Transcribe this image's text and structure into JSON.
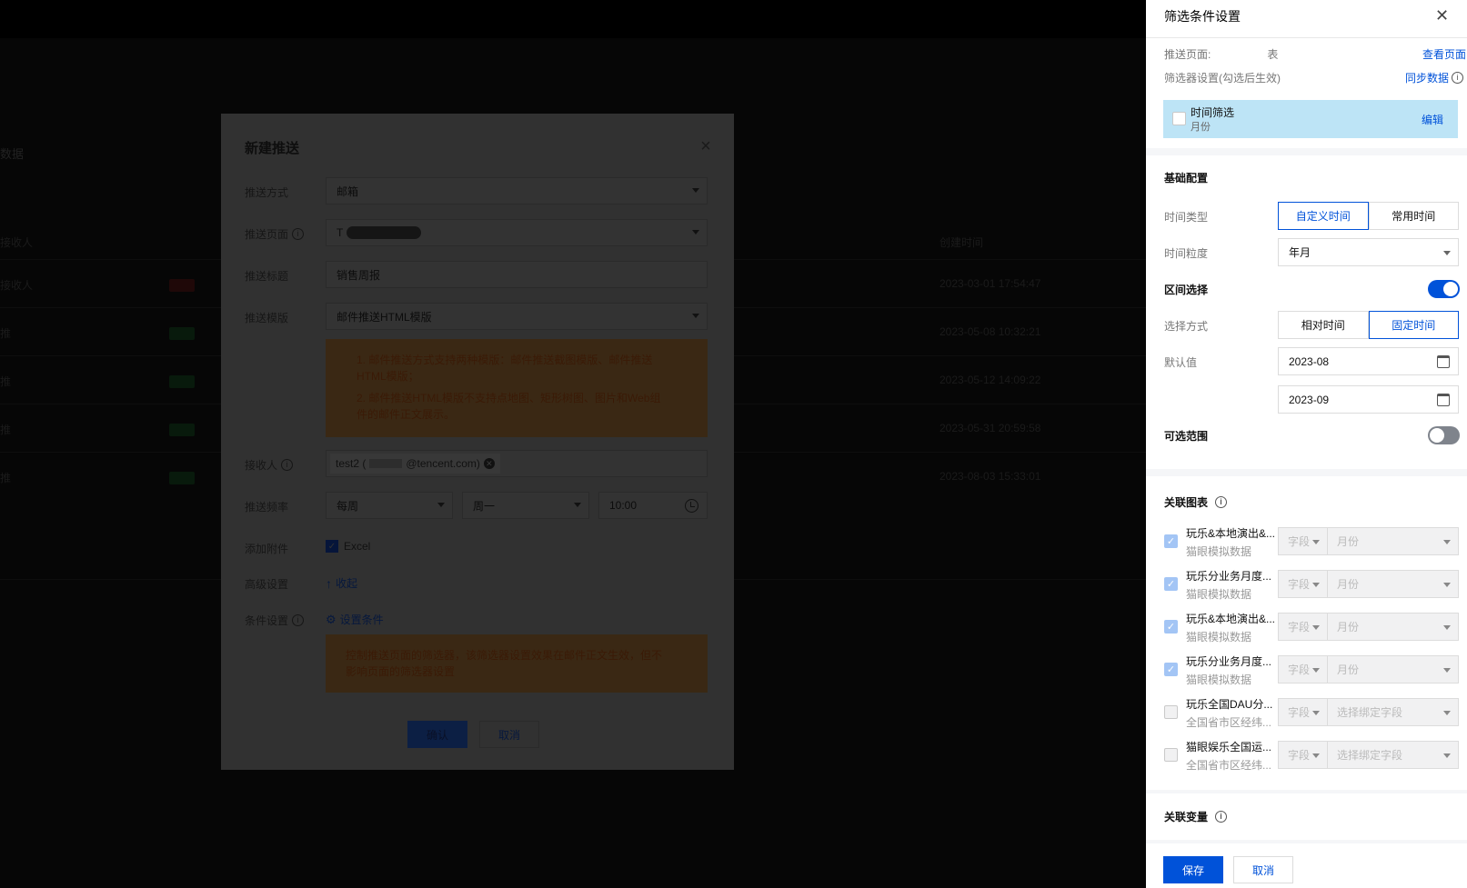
{
  "background": {
    "page_title": "数据",
    "col_left": "接收人",
    "col_right": "创建时间",
    "rows": [
      {
        "name": "接收人",
        "time": "2023-03-01 17:54:47"
      },
      {
        "name": "推",
        "time": "2023-05-08 10:32:21"
      },
      {
        "name": "推",
        "time": "2023-05-12 14:09:22"
      },
      {
        "name": "推",
        "time": "2023-05-31 20:59:58"
      },
      {
        "name": "推",
        "time": "2023-08-03 15:33:01"
      }
    ]
  },
  "modal": {
    "title": "新建推送",
    "fields": {
      "push_method": {
        "label": "推送方式",
        "value": "邮箱"
      },
      "push_page": {
        "label": "推送页面",
        "value": "T"
      },
      "push_title": {
        "label": "推送标题",
        "value": "销售周报"
      },
      "push_template": {
        "label": "推送模版",
        "value": "邮件推送HTML模版"
      },
      "receiver": {
        "label": "接收人",
        "tag": "test2 (",
        "tag_tail": "@tencent.com)"
      },
      "frequency": {
        "label": "推送频率",
        "period": "每周",
        "day": "周一",
        "time": "10:00"
      },
      "attachment": {
        "label": "添加附件",
        "option": "Excel"
      },
      "advanced": {
        "label": "高级设置",
        "link": "收起"
      },
      "condition": {
        "label": "条件设置",
        "link": "设置条件"
      }
    },
    "template_notice": [
      "1. 邮件推送方式支持两种模版：邮件推送截图模版、邮件推送HTML模版；",
      "2. 邮件推送HTML模版不支持点地图、矩形树图、图片和Web组件的邮件正文展示。"
    ],
    "condition_notice": "控制推送页面的筛选器，该筛选器设置效果在邮件正文生效，但不影响页面的筛选器设置",
    "confirm": "确认",
    "cancel": "取消"
  },
  "drawer": {
    "title": "筛选条件设置",
    "push_page_label": "推送页面:",
    "push_page_value": "表",
    "view_page": "查看页面",
    "filter_setting_label": "筛选器设置(勾选后生效)",
    "sync_data": "同步数据",
    "filter_item": {
      "name": "时间筛选",
      "sub": "月份",
      "edit": "编辑"
    },
    "basic_title": "基础配置",
    "time_type": {
      "label": "时间类型",
      "options": [
        "自定义时间",
        "常用时间"
      ],
      "active": "自定义时间"
    },
    "granularity": {
      "label": "时间粒度",
      "value": "年月"
    },
    "range_select": {
      "label": "区间选择",
      "on": true
    },
    "select_method": {
      "label": "选择方式",
      "options": [
        "相对时间",
        "固定时间"
      ],
      "active": "固定时间"
    },
    "default_value": {
      "label": "默认值",
      "start": "2023-08",
      "end": "2023-09"
    },
    "optional_range": {
      "label": "可选范围",
      "on": false
    },
    "related_charts_title": "关联图表",
    "charts": [
      {
        "name": "玩乐&本地演出&...",
        "sub": "猫眼模拟数据",
        "checked": true,
        "field": "字段",
        "value": "月份"
      },
      {
        "name": "玩乐分业务月度...",
        "sub": "猫眼模拟数据",
        "checked": true,
        "field": "字段",
        "value": "月份"
      },
      {
        "name": "玩乐&本地演出&...",
        "sub": "猫眼模拟数据",
        "checked": true,
        "field": "字段",
        "value": "月份"
      },
      {
        "name": "玩乐分业务月度...",
        "sub": "猫眼模拟数据",
        "checked": true,
        "field": "字段",
        "value": "月份"
      },
      {
        "name": "玩乐全国DAU分...",
        "sub": "全国省市区经纬...",
        "checked": false,
        "field": "字段",
        "value": "选择绑定字段"
      },
      {
        "name": "猫眼娱乐全国运...",
        "sub": "全国省市区经纬...",
        "checked": false,
        "field": "字段",
        "value": "选择绑定字段"
      }
    ],
    "related_vars_title": "关联变量",
    "save": "保存",
    "cancel": "取消"
  },
  "colors": {
    "accent": "#0052d9",
    "filter_bg": "#bde4f6",
    "toggle_off": "#7f848c"
  }
}
